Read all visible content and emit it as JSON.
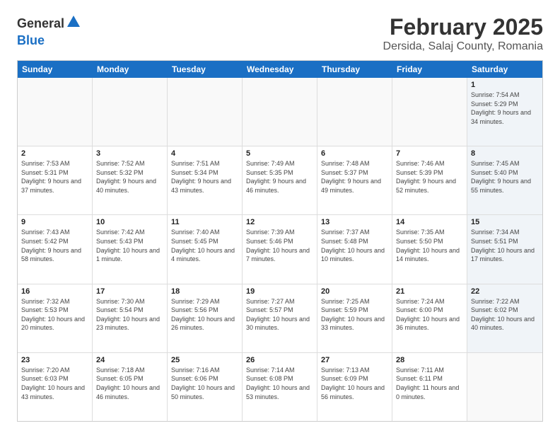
{
  "header": {
    "logo_general": "General",
    "logo_blue": "Blue",
    "main_title": "February 2025",
    "subtitle": "Dersida, Salaj County, Romania"
  },
  "days_of_week": [
    "Sunday",
    "Monday",
    "Tuesday",
    "Wednesday",
    "Thursday",
    "Friday",
    "Saturday"
  ],
  "weeks": [
    [
      {
        "day": "",
        "info": "",
        "empty": true
      },
      {
        "day": "",
        "info": "",
        "empty": true
      },
      {
        "day": "",
        "info": "",
        "empty": true
      },
      {
        "day": "",
        "info": "",
        "empty": true
      },
      {
        "day": "",
        "info": "",
        "empty": true
      },
      {
        "day": "",
        "info": "",
        "empty": true
      },
      {
        "day": "1",
        "info": "Sunrise: 7:54 AM\nSunset: 5:29 PM\nDaylight: 9 hours and 34 minutes.",
        "empty": false,
        "alt": true
      }
    ],
    [
      {
        "day": "2",
        "info": "Sunrise: 7:53 AM\nSunset: 5:31 PM\nDaylight: 9 hours and 37 minutes.",
        "empty": false,
        "alt": false
      },
      {
        "day": "3",
        "info": "Sunrise: 7:52 AM\nSunset: 5:32 PM\nDaylight: 9 hours and 40 minutes.",
        "empty": false,
        "alt": false
      },
      {
        "day": "4",
        "info": "Sunrise: 7:51 AM\nSunset: 5:34 PM\nDaylight: 9 hours and 43 minutes.",
        "empty": false,
        "alt": false
      },
      {
        "day": "5",
        "info": "Sunrise: 7:49 AM\nSunset: 5:35 PM\nDaylight: 9 hours and 46 minutes.",
        "empty": false,
        "alt": false
      },
      {
        "day": "6",
        "info": "Sunrise: 7:48 AM\nSunset: 5:37 PM\nDaylight: 9 hours and 49 minutes.",
        "empty": false,
        "alt": false
      },
      {
        "day": "7",
        "info": "Sunrise: 7:46 AM\nSunset: 5:39 PM\nDaylight: 9 hours and 52 minutes.",
        "empty": false,
        "alt": false
      },
      {
        "day": "8",
        "info": "Sunrise: 7:45 AM\nSunset: 5:40 PM\nDaylight: 9 hours and 55 minutes.",
        "empty": false,
        "alt": true
      }
    ],
    [
      {
        "day": "9",
        "info": "Sunrise: 7:43 AM\nSunset: 5:42 PM\nDaylight: 9 hours and 58 minutes.",
        "empty": false,
        "alt": false
      },
      {
        "day": "10",
        "info": "Sunrise: 7:42 AM\nSunset: 5:43 PM\nDaylight: 10 hours and 1 minute.",
        "empty": false,
        "alt": false
      },
      {
        "day": "11",
        "info": "Sunrise: 7:40 AM\nSunset: 5:45 PM\nDaylight: 10 hours and 4 minutes.",
        "empty": false,
        "alt": false
      },
      {
        "day": "12",
        "info": "Sunrise: 7:39 AM\nSunset: 5:46 PM\nDaylight: 10 hours and 7 minutes.",
        "empty": false,
        "alt": false
      },
      {
        "day": "13",
        "info": "Sunrise: 7:37 AM\nSunset: 5:48 PM\nDaylight: 10 hours and 10 minutes.",
        "empty": false,
        "alt": false
      },
      {
        "day": "14",
        "info": "Sunrise: 7:35 AM\nSunset: 5:50 PM\nDaylight: 10 hours and 14 minutes.",
        "empty": false,
        "alt": false
      },
      {
        "day": "15",
        "info": "Sunrise: 7:34 AM\nSunset: 5:51 PM\nDaylight: 10 hours and 17 minutes.",
        "empty": false,
        "alt": true
      }
    ],
    [
      {
        "day": "16",
        "info": "Sunrise: 7:32 AM\nSunset: 5:53 PM\nDaylight: 10 hours and 20 minutes.",
        "empty": false,
        "alt": false
      },
      {
        "day": "17",
        "info": "Sunrise: 7:30 AM\nSunset: 5:54 PM\nDaylight: 10 hours and 23 minutes.",
        "empty": false,
        "alt": false
      },
      {
        "day": "18",
        "info": "Sunrise: 7:29 AM\nSunset: 5:56 PM\nDaylight: 10 hours and 26 minutes.",
        "empty": false,
        "alt": false
      },
      {
        "day": "19",
        "info": "Sunrise: 7:27 AM\nSunset: 5:57 PM\nDaylight: 10 hours and 30 minutes.",
        "empty": false,
        "alt": false
      },
      {
        "day": "20",
        "info": "Sunrise: 7:25 AM\nSunset: 5:59 PM\nDaylight: 10 hours and 33 minutes.",
        "empty": false,
        "alt": false
      },
      {
        "day": "21",
        "info": "Sunrise: 7:24 AM\nSunset: 6:00 PM\nDaylight: 10 hours and 36 minutes.",
        "empty": false,
        "alt": false
      },
      {
        "day": "22",
        "info": "Sunrise: 7:22 AM\nSunset: 6:02 PM\nDaylight: 10 hours and 40 minutes.",
        "empty": false,
        "alt": true
      }
    ],
    [
      {
        "day": "23",
        "info": "Sunrise: 7:20 AM\nSunset: 6:03 PM\nDaylight: 10 hours and 43 minutes.",
        "empty": false,
        "alt": false
      },
      {
        "day": "24",
        "info": "Sunrise: 7:18 AM\nSunset: 6:05 PM\nDaylight: 10 hours and 46 minutes.",
        "empty": false,
        "alt": false
      },
      {
        "day": "25",
        "info": "Sunrise: 7:16 AM\nSunset: 6:06 PM\nDaylight: 10 hours and 50 minutes.",
        "empty": false,
        "alt": false
      },
      {
        "day": "26",
        "info": "Sunrise: 7:14 AM\nSunset: 6:08 PM\nDaylight: 10 hours and 53 minutes.",
        "empty": false,
        "alt": false
      },
      {
        "day": "27",
        "info": "Sunrise: 7:13 AM\nSunset: 6:09 PM\nDaylight: 10 hours and 56 minutes.",
        "empty": false,
        "alt": false
      },
      {
        "day": "28",
        "info": "Sunrise: 7:11 AM\nSunset: 6:11 PM\nDaylight: 11 hours and 0 minutes.",
        "empty": false,
        "alt": false
      },
      {
        "day": "",
        "info": "",
        "empty": true,
        "alt": true
      }
    ]
  ]
}
